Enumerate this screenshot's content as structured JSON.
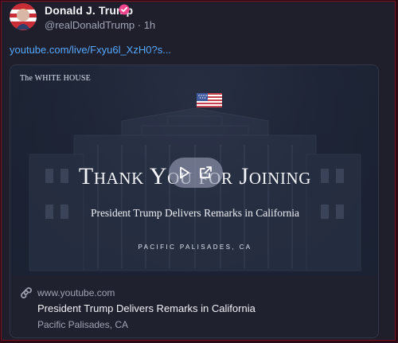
{
  "author": {
    "name": "Donald J. Trump",
    "handle_line": "@realDonaldTrump · 1h"
  },
  "post": {
    "link_text": "youtube.com/live/Fxyu6l_XzH0?s..."
  },
  "card": {
    "brand": "The WHITE HOUSE",
    "headline": "Thank You for Joining",
    "subheadline": "President Trump Delivers Remarks in California",
    "location": "PACIFIC PALISADES, CA",
    "domain": "www.youtube.com",
    "title": "President Trump Delivers Remarks in California",
    "subtitle": "Pacific Palisades, CA"
  },
  "icons": {
    "avatar": "avatar",
    "verified": "verified-badge-icon",
    "flag": "flag-icon",
    "play": "play-icon",
    "external": "external-link-icon",
    "link": "link-icon"
  },
  "colors": {
    "background": "#1e1f2b",
    "accent_link": "#56a8ff",
    "verified": "#f0468f",
    "card_border": "#33364a"
  }
}
